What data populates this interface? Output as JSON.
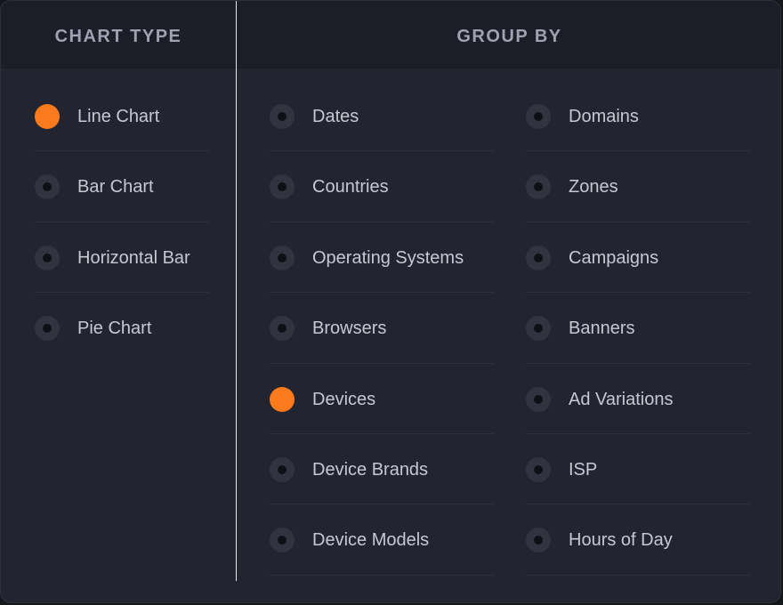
{
  "headers": {
    "chart_type": "CHART TYPE",
    "group_by": "GROUP BY"
  },
  "chart_type": {
    "selected": "Line Chart",
    "options": [
      "Line Chart",
      "Bar Chart",
      "Horizontal Bar",
      "Pie Chart"
    ]
  },
  "group_by": {
    "selected": "Devices",
    "column1": [
      "Dates",
      "Countries",
      "Operating Systems",
      "Browsers",
      "Devices",
      "Device Brands",
      "Device Models"
    ],
    "column2": [
      "Domains",
      "Zones",
      "Campaigns",
      "Banners",
      "Ad Variations",
      "ISP",
      "Hours of Day"
    ]
  },
  "colors": {
    "accent": "#fb7a1c",
    "panel_bg": "#222430",
    "header_bg": "#1c1d26",
    "text": "#c6c8d2",
    "header_text": "#9ea2b1"
  }
}
